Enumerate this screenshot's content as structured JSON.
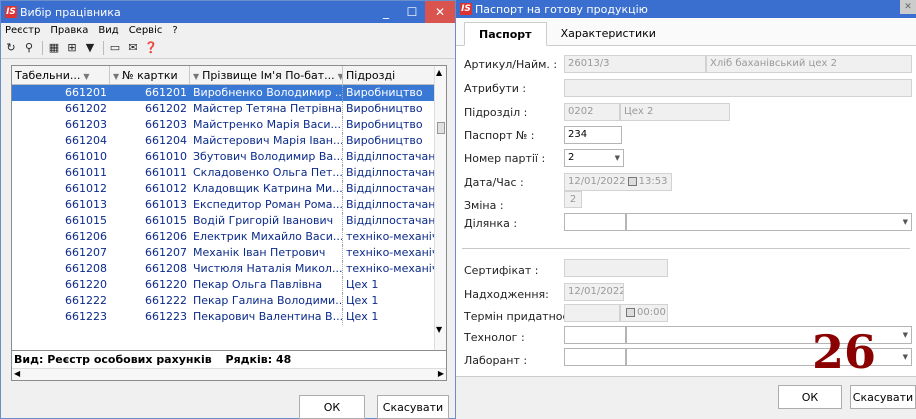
{
  "left_window": {
    "title": "Вибір працівника",
    "menu": [
      "Реєстр",
      "Правка",
      "Вид",
      "Сервіс",
      "?"
    ],
    "columns": [
      "Табельни...",
      "№ картки",
      "Прізвище Ім'я По-бат...",
      "Підрозді"
    ],
    "rows": [
      {
        "tab": "661201",
        "card": "661201",
        "name": "Виробненко Володимир ...",
        "dept": "Виробництво",
        "selected": true
      },
      {
        "tab": "661202",
        "card": "661202",
        "name": "Майстер Тетяна Петрівна",
        "dept": "Виробництво"
      },
      {
        "tab": "661203",
        "card": "661203",
        "name": "Майстренко Марія Васи...",
        "dept": "Виробництво"
      },
      {
        "tab": "661204",
        "card": "661204",
        "name": "Майстерович Марія Іван...",
        "dept": "Виробництво"
      },
      {
        "tab": "661010",
        "card": "661010",
        "name": "Збутович Володимир Ва...",
        "dept": "Відділпостачання і"
      },
      {
        "tab": "661011",
        "card": "661011",
        "name": "Складовенко Ольга Пет...",
        "dept": "Відділпостачання і"
      },
      {
        "tab": "661012",
        "card": "661012",
        "name": "Кладовщик Катрина Ми...",
        "dept": "Відділпостачання і"
      },
      {
        "tab": "661013",
        "card": "661013",
        "name": "Експедитор Роман Рома...",
        "dept": "Відділпостачання і"
      },
      {
        "tab": "661015",
        "card": "661015",
        "name": "Водій Григорій Іванович",
        "dept": "Відділпостачання і"
      },
      {
        "tab": "661206",
        "card": "661206",
        "name": "Електрик Михайло Васи...",
        "dept": "техніко-механічний"
      },
      {
        "tab": "661207",
        "card": "661207",
        "name": "Механік Іван Петрович",
        "dept": "техніко-механічний"
      },
      {
        "tab": "661208",
        "card": "661208",
        "name": "Чистюля Наталія Микол...",
        "dept": "техніко-механічний"
      },
      {
        "tab": "661220",
        "card": "661220",
        "name": "Пекар Ольга Павлівна",
        "dept": "Цех 1"
      },
      {
        "tab": "661222",
        "card": "661222",
        "name": "Пекар Галина Володими...",
        "dept": "Цех 1"
      },
      {
        "tab": "661223",
        "card": "661223",
        "name": "Пекарович Валентина В...",
        "dept": "Цех 1"
      }
    ],
    "status_view": "Вид: Реєстр особових рахунків",
    "status_rows": "Рядків: 48",
    "ok_label": "ОК",
    "cancel_label": "Скасувати"
  },
  "right_window": {
    "title": "Паспорт на готову продукцію",
    "tabs": [
      "Паспорт",
      "Характеристики"
    ],
    "labels": {
      "article": "Артикул/Найм. :",
      "attributes": "Атрибути :",
      "division": "Підрозділ :",
      "passport_no": "Паспорт № :",
      "batch_no": "Номер партії :",
      "datetime": "Дата/Час :",
      "shift": "Зміна :",
      "section": "Ділянка :",
      "certificate": "Сертифікат :",
      "receipt": "Надходження:",
      "shelf_life": "Термін придатност",
      "technologist": "Технолог :",
      "lab": "Лаборант :"
    },
    "values": {
      "article_code": "26013/3",
      "article_name": "Хліб баханівський цех 2",
      "division_code": "0202",
      "division_name": "Цех 2",
      "passport_no": "234",
      "batch_no": "2",
      "date": "12/01/2022",
      "time": "13:53",
      "shift": "2",
      "receipt_date": "12/01/2022",
      "shelf_time": "00:00"
    },
    "badge": "26",
    "ok_label": "ОК",
    "cancel_label": "Скасувати"
  }
}
